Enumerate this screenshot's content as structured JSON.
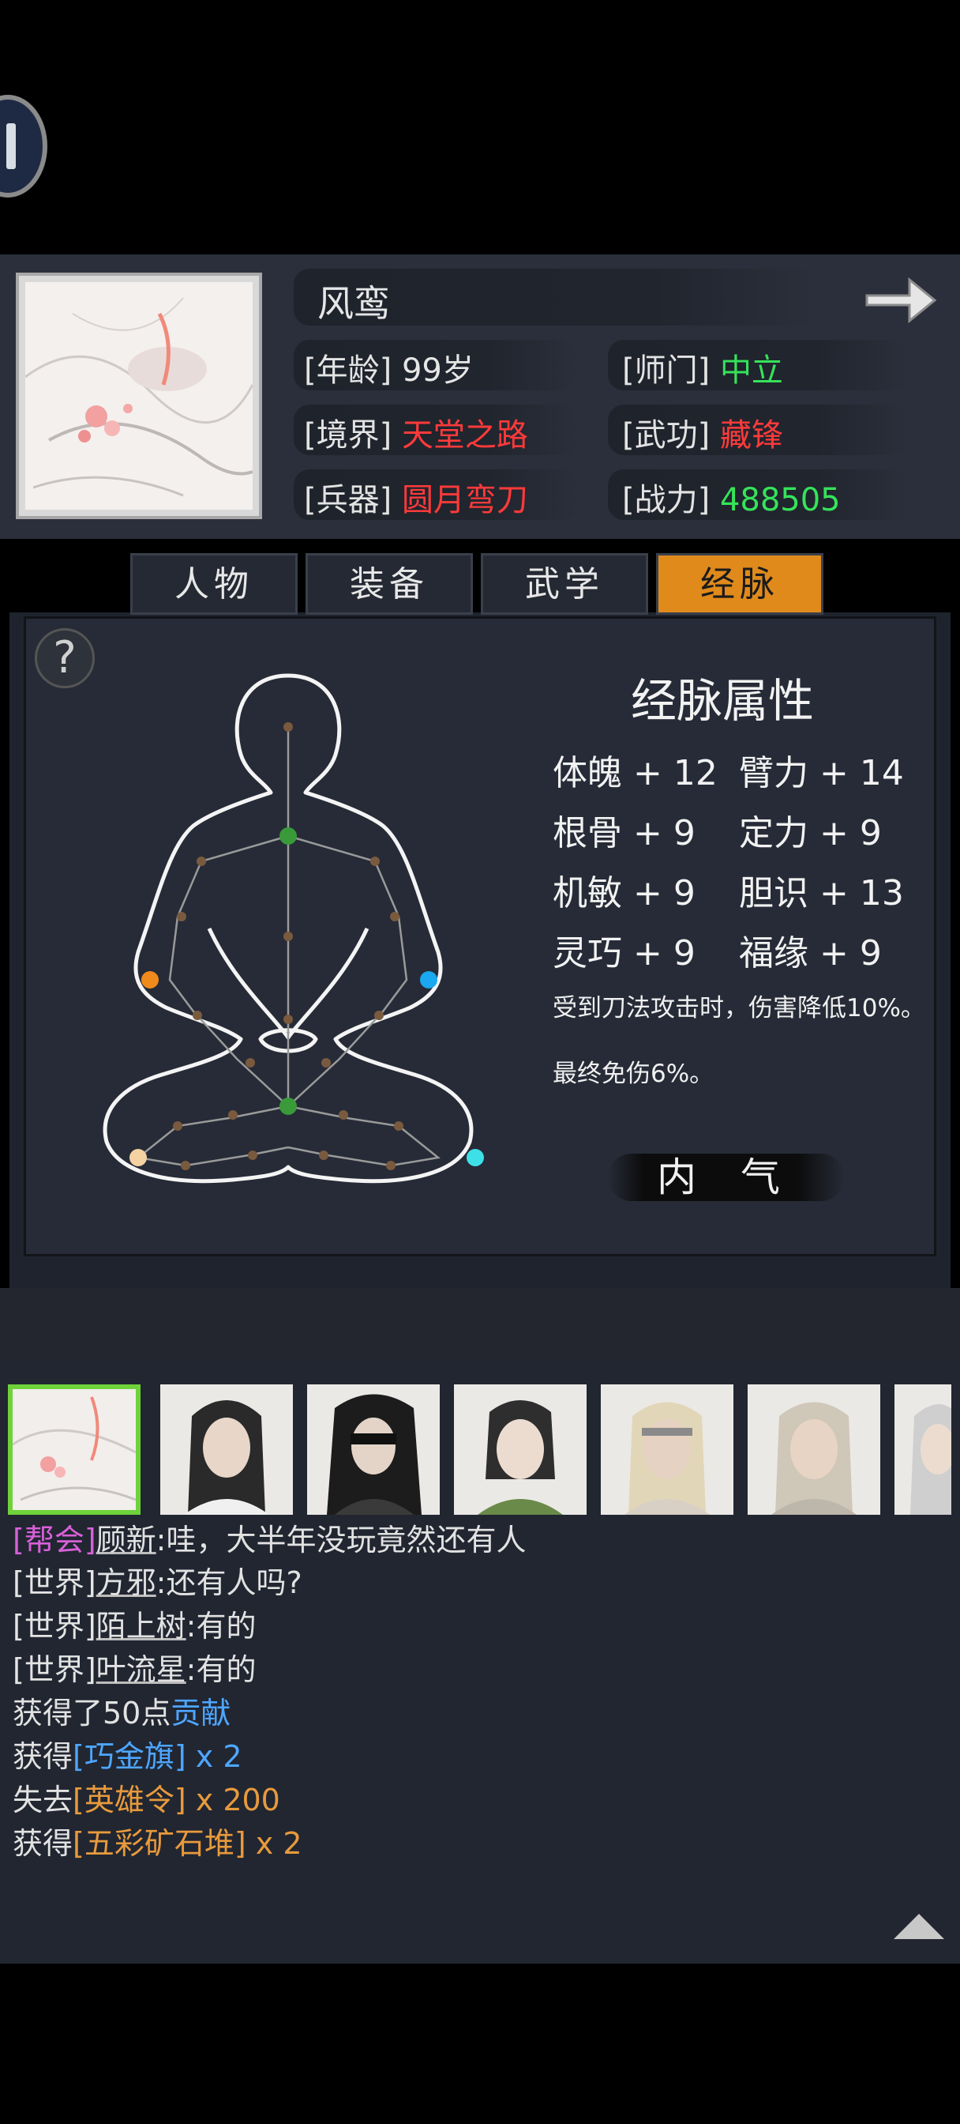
{
  "profile": {
    "name": "风鸾",
    "age_label": "[年龄]",
    "age_value": "99岁",
    "sect_label": "[师门]",
    "sect_value": "中立",
    "realm_label": "[境界]",
    "realm_value": "天堂之路",
    "skill_label": "[武功]",
    "skill_value": "藏锋",
    "weapon_label": "[兵器]",
    "weapon_value": "圆月弯刀",
    "power_label": "[战力]",
    "power_value": "488505"
  },
  "tabs": [
    {
      "label": "人物",
      "active": false
    },
    {
      "label": "装备",
      "active": false
    },
    {
      "label": "武学",
      "active": false
    },
    {
      "label": "经脉",
      "active": true
    }
  ],
  "meridian": {
    "title": "经脉属性",
    "attrs": [
      "体魄 + 12",
      "臂力 + 14",
      "根骨 + 9",
      "定力 + 9",
      "机敏 + 9",
      "胆识 + 13",
      "灵巧 + 9",
      "福缘 + 9"
    ],
    "note1": "受到刀法攻击时，伤害降低10%。",
    "note2": "最终免伤6%。",
    "neiqi_button": "内 气"
  },
  "chat": {
    "lines": [
      {
        "tag": "[帮会]",
        "user": "顾新",
        "text": ":哇，大半年没玩竟然还有人"
      },
      {
        "tag": "[世界]",
        "user": "方邪",
        "text": ":还有人吗?"
      },
      {
        "tag": "[世界]",
        "user": "陌上树",
        "text": ":有的"
      },
      {
        "tag": "[世界]",
        "user": "叶流星",
        "text": ":有的"
      }
    ],
    "sys1_prefix": "获得了50点",
    "sys1_item": "贡献",
    "sys2_prefix": "获得",
    "sys2_item": "[巧金旗]",
    "sys2_qty": " x 2",
    "sys3_prefix": "失去",
    "sys3_item": "[英雄令]",
    "sys3_qty": " x 200",
    "sys4_prefix": "获得",
    "sys4_item": "[五彩矿石堆]",
    "sys4_qty": " x 2"
  },
  "colors": {
    "accent_tab": "#e08a1c",
    "red_value": "#ff3a3a",
    "green_value": "#35e35a",
    "guild_tag": "#d860d8",
    "item_blue": "#4ea6ff",
    "item_orange": "#e89a3c",
    "avatar_selected": "#6fd23a"
  }
}
